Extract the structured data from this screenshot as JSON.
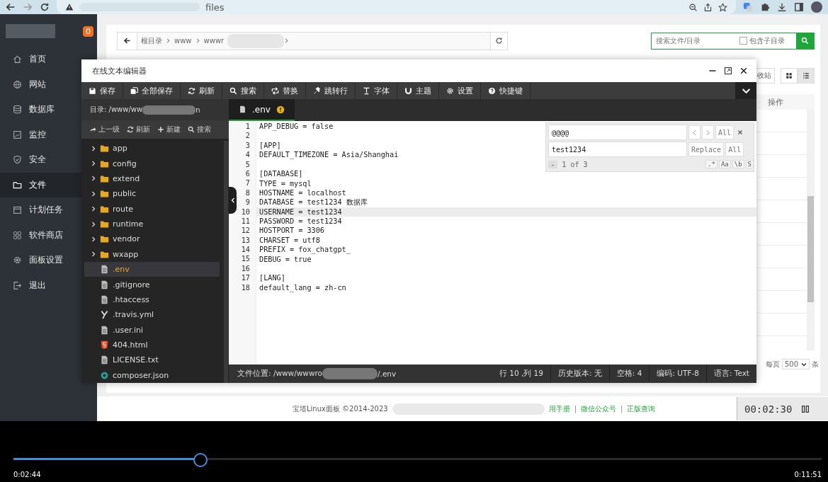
{
  "browser": {
    "address": "files"
  },
  "sidebar": {
    "badge": "0",
    "items": [
      {
        "label": "首页",
        "selected": false
      },
      {
        "label": "网站",
        "selected": false
      },
      {
        "label": "数据库",
        "selected": false
      },
      {
        "label": "监控",
        "selected": false
      },
      {
        "label": "安全",
        "selected": false
      },
      {
        "label": "文件",
        "selected": true
      },
      {
        "label": "计划任务",
        "selected": false
      },
      {
        "label": "软件商店",
        "selected": false
      },
      {
        "label": "面板设置",
        "selected": false
      },
      {
        "label": "退出",
        "selected": false
      }
    ]
  },
  "breadcrumb": {
    "items": [
      "根目录",
      "www",
      "wwwr"
    ]
  },
  "file_search": {
    "placeholder": "搜索文件/目录",
    "include_subdirs": {
      "label": "包含子目录",
      "checked": false
    }
  },
  "recycle_bin": "收站",
  "view_modes": [
    {
      "kind": "grid",
      "selected": false
    },
    {
      "kind": "list",
      "selected": true
    }
  ],
  "table": {
    "columns": [
      "操作"
    ]
  },
  "pagination": {
    "per_page_label": "每页",
    "per_page": "500",
    "unit": "条"
  },
  "footer": {
    "copyright": "宝塔Linux面板 ©2014-2023",
    "links": [
      "用手册",
      "微信公众号",
      "正版查询"
    ],
    "separators": [
      "|",
      "|"
    ]
  },
  "recorder": {
    "time": "00:02:30"
  },
  "editor": {
    "title": "在线文本编辑器",
    "toolbar": [
      "保存",
      "全部保存",
      "刷新",
      "搜索",
      "替换",
      "跳转行",
      "字体",
      "主题",
      "设置",
      "快捷键"
    ],
    "directory": {
      "label": "目录: /www/ww",
      "tail": "n"
    },
    "tree_toolbar": [
      "上一级",
      "刷新",
      "新建",
      "搜索"
    ],
    "tree": [
      {
        "name": "app",
        "kind": "folder",
        "expanded": false,
        "selected": false
      },
      {
        "name": "config",
        "kind": "folder",
        "expanded": false,
        "selected": false
      },
      {
        "name": "extend",
        "kind": "folder",
        "expanded": false,
        "selected": false
      },
      {
        "name": "public",
        "kind": "folder",
        "expanded": false,
        "selected": false
      },
      {
        "name": "route",
        "kind": "folder",
        "expanded": false,
        "selected": false
      },
      {
        "name": "runtime",
        "kind": "folder",
        "expanded": false,
        "selected": false
      },
      {
        "name": "vendor",
        "kind": "folder",
        "expanded": false,
        "selected": false
      },
      {
        "name": "wxapp",
        "kind": "folder",
        "expanded": false,
        "selected": false
      },
      {
        "name": ".env",
        "kind": "text",
        "selected": true
      },
      {
        "name": ".gitignore",
        "kind": "text",
        "selected": false
      },
      {
        "name": ".htaccess",
        "kind": "text",
        "selected": false
      },
      {
        "name": ".travis.yml",
        "kind": "yaml",
        "selected": false
      },
      {
        "name": ".user.ini",
        "kind": "text",
        "selected": false
      },
      {
        "name": "404.html",
        "kind": "html",
        "selected": false
      },
      {
        "name": "LICENSE.txt",
        "kind": "text",
        "selected": false
      },
      {
        "name": "composer.json",
        "kind": "json",
        "selected": false
      }
    ],
    "tabs": [
      {
        "name": ".env",
        "modified": true,
        "selected": true
      }
    ],
    "lines": [
      {
        "number": "1",
        "text": "APP_DEBUG = false",
        "current": false
      },
      {
        "number": "2",
        "current": false
      },
      {
        "number": "3",
        "text": "[APP]",
        "current": false
      },
      {
        "number": "4",
        "text": "DEFAULT_TIMEZONE = Asia/Shanghai",
        "current": false
      },
      {
        "number": "5",
        "current": false
      },
      {
        "number": "6",
        "text": "[DATABASE]",
        "current": false
      },
      {
        "number": "7",
        "text": "TYPE = mysql",
        "current": false
      },
      {
        "number": "8",
        "text": "HOSTNAME = localhost",
        "current": false
      },
      {
        "number": "9",
        "text": "DATABASE = test1234 数据库",
        "current": false
      },
      {
        "number": "10",
        "text": "USERNAME = test1234",
        "current": true
      },
      {
        "number": "11",
        "text": "PASSWORD = test1234",
        "current": false
      },
      {
        "number": "12",
        "text": "HOSTPORT = 3306",
        "current": false
      },
      {
        "number": "13",
        "text": "CHARSET = utf8",
        "current": false
      },
      {
        "number": "14",
        "text": "PREFIX = fox_chatgpt_",
        "current": false
      },
      {
        "number": "15",
        "text": "DEBUG = true",
        "current": false
      },
      {
        "number": "16",
        "current": false
      },
      {
        "number": "17",
        "text": "[LANG]",
        "current": false
      },
      {
        "number": "18",
        "text": "default_lang = zh-cn",
        "current": false
      }
    ],
    "search": {
      "find": "@@@@",
      "find_all": "All",
      "replace": "test1234",
      "replace_button": "Replace",
      "replace_all": "All",
      "collapse": "-",
      "count": "1 of 3",
      "options": [
        ".*",
        "Aa",
        "\\b",
        "S"
      ]
    },
    "status": {
      "path": "文件位置: /www/wwwro",
      "path_tail": "/.env",
      "items": [
        "行 10 ,列 19",
        "历史版本: 无",
        "空格: 4",
        "编码: UTF-8",
        "语言: Text"
      ]
    }
  },
  "video": {
    "level": 0.2307,
    "elapsed": "0:02:44",
    "duration": "0:11:51"
  }
}
